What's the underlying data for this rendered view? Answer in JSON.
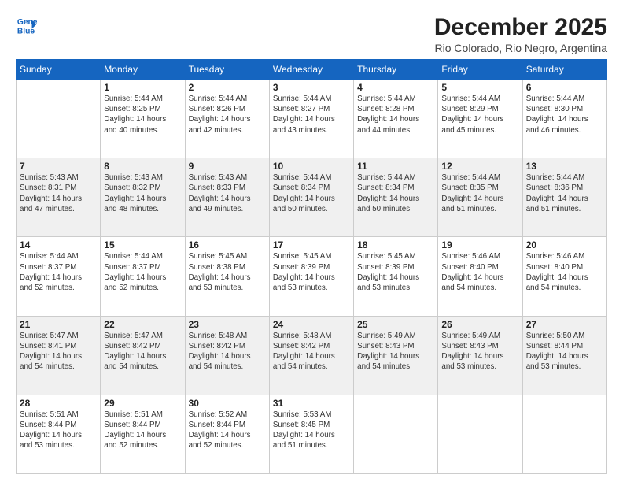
{
  "header": {
    "logo_line1": "General",
    "logo_line2": "Blue",
    "title": "December 2025",
    "subtitle": "Rio Colorado, Rio Negro, Argentina"
  },
  "weekdays": [
    "Sunday",
    "Monday",
    "Tuesday",
    "Wednesday",
    "Thursday",
    "Friday",
    "Saturday"
  ],
  "weeks": [
    [
      {
        "day": "",
        "info": ""
      },
      {
        "day": "1",
        "info": "Sunrise: 5:44 AM\nSunset: 8:25 PM\nDaylight: 14 hours\nand 40 minutes."
      },
      {
        "day": "2",
        "info": "Sunrise: 5:44 AM\nSunset: 8:26 PM\nDaylight: 14 hours\nand 42 minutes."
      },
      {
        "day": "3",
        "info": "Sunrise: 5:44 AM\nSunset: 8:27 PM\nDaylight: 14 hours\nand 43 minutes."
      },
      {
        "day": "4",
        "info": "Sunrise: 5:44 AM\nSunset: 8:28 PM\nDaylight: 14 hours\nand 44 minutes."
      },
      {
        "day": "5",
        "info": "Sunrise: 5:44 AM\nSunset: 8:29 PM\nDaylight: 14 hours\nand 45 minutes."
      },
      {
        "day": "6",
        "info": "Sunrise: 5:44 AM\nSunset: 8:30 PM\nDaylight: 14 hours\nand 46 minutes."
      }
    ],
    [
      {
        "day": "7",
        "info": "Sunrise: 5:43 AM\nSunset: 8:31 PM\nDaylight: 14 hours\nand 47 minutes."
      },
      {
        "day": "8",
        "info": "Sunrise: 5:43 AM\nSunset: 8:32 PM\nDaylight: 14 hours\nand 48 minutes."
      },
      {
        "day": "9",
        "info": "Sunrise: 5:43 AM\nSunset: 8:33 PM\nDaylight: 14 hours\nand 49 minutes."
      },
      {
        "day": "10",
        "info": "Sunrise: 5:44 AM\nSunset: 8:34 PM\nDaylight: 14 hours\nand 50 minutes."
      },
      {
        "day": "11",
        "info": "Sunrise: 5:44 AM\nSunset: 8:34 PM\nDaylight: 14 hours\nand 50 minutes."
      },
      {
        "day": "12",
        "info": "Sunrise: 5:44 AM\nSunset: 8:35 PM\nDaylight: 14 hours\nand 51 minutes."
      },
      {
        "day": "13",
        "info": "Sunrise: 5:44 AM\nSunset: 8:36 PM\nDaylight: 14 hours\nand 51 minutes."
      }
    ],
    [
      {
        "day": "14",
        "info": "Sunrise: 5:44 AM\nSunset: 8:37 PM\nDaylight: 14 hours\nand 52 minutes."
      },
      {
        "day": "15",
        "info": "Sunrise: 5:44 AM\nSunset: 8:37 PM\nDaylight: 14 hours\nand 52 minutes."
      },
      {
        "day": "16",
        "info": "Sunrise: 5:45 AM\nSunset: 8:38 PM\nDaylight: 14 hours\nand 53 minutes."
      },
      {
        "day": "17",
        "info": "Sunrise: 5:45 AM\nSunset: 8:39 PM\nDaylight: 14 hours\nand 53 minutes."
      },
      {
        "day": "18",
        "info": "Sunrise: 5:45 AM\nSunset: 8:39 PM\nDaylight: 14 hours\nand 53 minutes."
      },
      {
        "day": "19",
        "info": "Sunrise: 5:46 AM\nSunset: 8:40 PM\nDaylight: 14 hours\nand 54 minutes."
      },
      {
        "day": "20",
        "info": "Sunrise: 5:46 AM\nSunset: 8:40 PM\nDaylight: 14 hours\nand 54 minutes."
      }
    ],
    [
      {
        "day": "21",
        "info": "Sunrise: 5:47 AM\nSunset: 8:41 PM\nDaylight: 14 hours\nand 54 minutes."
      },
      {
        "day": "22",
        "info": "Sunrise: 5:47 AM\nSunset: 8:42 PM\nDaylight: 14 hours\nand 54 minutes."
      },
      {
        "day": "23",
        "info": "Sunrise: 5:48 AM\nSunset: 8:42 PM\nDaylight: 14 hours\nand 54 minutes."
      },
      {
        "day": "24",
        "info": "Sunrise: 5:48 AM\nSunset: 8:42 PM\nDaylight: 14 hours\nand 54 minutes."
      },
      {
        "day": "25",
        "info": "Sunrise: 5:49 AM\nSunset: 8:43 PM\nDaylight: 14 hours\nand 54 minutes."
      },
      {
        "day": "26",
        "info": "Sunrise: 5:49 AM\nSunset: 8:43 PM\nDaylight: 14 hours\nand 53 minutes."
      },
      {
        "day": "27",
        "info": "Sunrise: 5:50 AM\nSunset: 8:44 PM\nDaylight: 14 hours\nand 53 minutes."
      }
    ],
    [
      {
        "day": "28",
        "info": "Sunrise: 5:51 AM\nSunset: 8:44 PM\nDaylight: 14 hours\nand 53 minutes."
      },
      {
        "day": "29",
        "info": "Sunrise: 5:51 AM\nSunset: 8:44 PM\nDaylight: 14 hours\nand 52 minutes."
      },
      {
        "day": "30",
        "info": "Sunrise: 5:52 AM\nSunset: 8:44 PM\nDaylight: 14 hours\nand 52 minutes."
      },
      {
        "day": "31",
        "info": "Sunrise: 5:53 AM\nSunset: 8:45 PM\nDaylight: 14 hours\nand 51 minutes."
      },
      {
        "day": "",
        "info": ""
      },
      {
        "day": "",
        "info": ""
      },
      {
        "day": "",
        "info": ""
      }
    ]
  ]
}
